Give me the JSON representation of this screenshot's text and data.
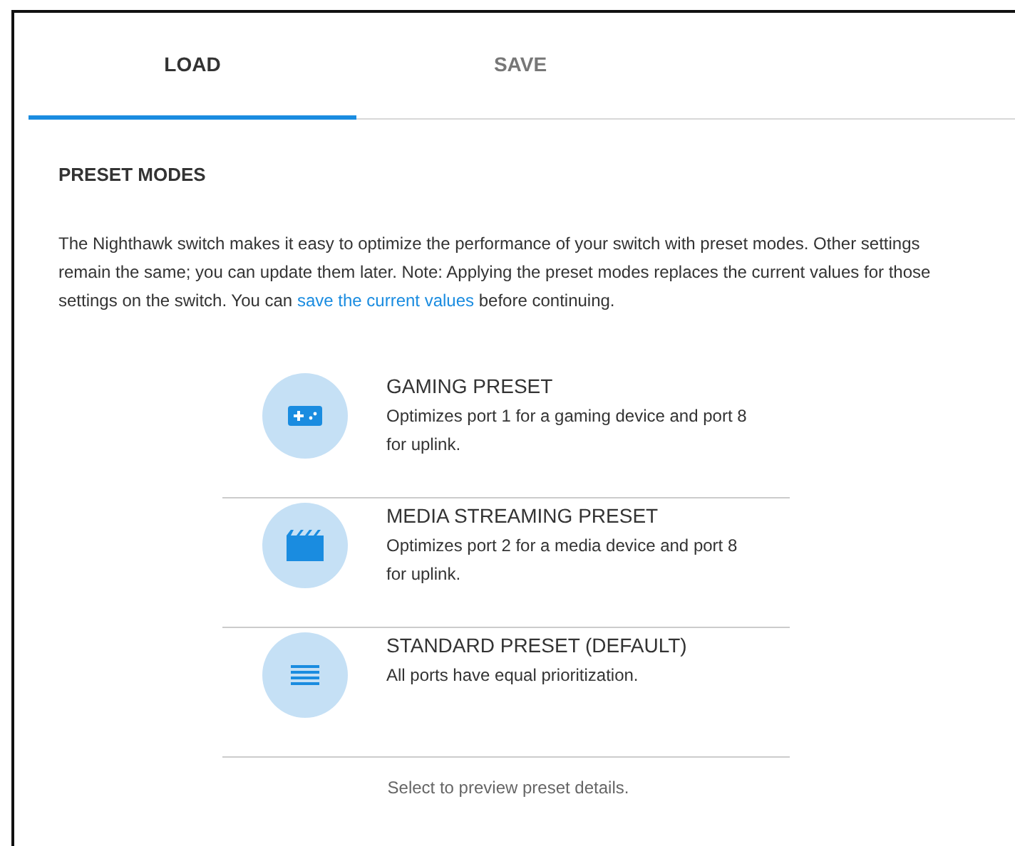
{
  "tabs": [
    {
      "label": "LOAD",
      "selected": true
    },
    {
      "label": "SAVE",
      "selected": false
    }
  ],
  "section": {
    "title": "PRESET MODES",
    "intro": {
      "text_before": "The Nighthawk switch makes it easy to optimize the performance of your switch with preset modes. Other settings remain the same; you can update them later. Note: Applying the preset modes replaces the current values for those settings on the switch. You can ",
      "link": "save the current values",
      "text_after": " before continuing."
    },
    "presets": [
      {
        "kind": "gaming",
        "title": "GAMING PRESET",
        "description": "Optimizes port 1 for a gaming device and port 8 for uplink."
      },
      {
        "kind": "media",
        "title": "MEDIA STREAMING PRESET",
        "description": "Optimizes port 2 for a media device and port 8 for uplink."
      },
      {
        "kind": "standard",
        "title": "STANDARD PRESET (DEFAULT)",
        "description": "All ports have equal prioritization."
      }
    ],
    "hint": "Select to preview preset details."
  }
}
